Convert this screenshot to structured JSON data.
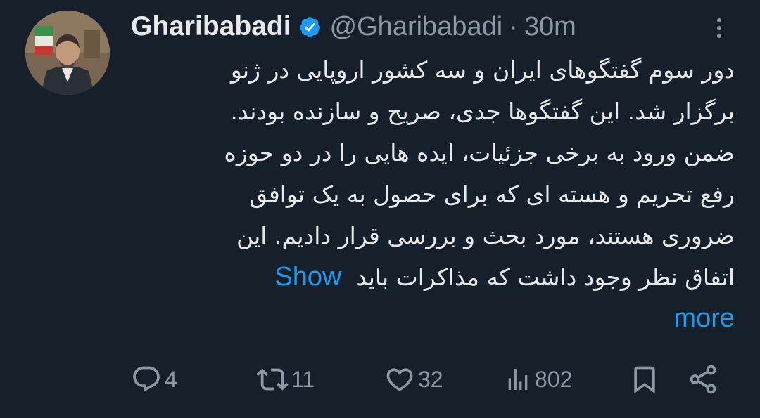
{
  "tweet": {
    "author_name": "Gharibabadi",
    "author_handle": "@Gharibabadi",
    "separator": "·",
    "time": "30m",
    "text_lines": [
      "دور سوم گفتگوهای ایران و سه کشور اروپایی در ژنو",
      "برگزار شد. این گفتگوها جدی، صریح و سازنده بودند.",
      "ضمن ورود به برخی جزئیات، ایده هایی را در دو حوزه",
      "رفع تحریم و هسته ای که برای حصول به یک توافق",
      "ضروری هستند، مورد بحث و بررسی قرار دادیم. این",
      "اتفاق نظر وجود داشت که مذاکرات باید"
    ],
    "show_more_1": "Show",
    "show_more_2": "more"
  },
  "actions": {
    "replies": "4",
    "reposts": "11",
    "likes": "32",
    "views": "802"
  },
  "icons": {
    "verified": "verified-badge-icon",
    "more": "more-options-icon",
    "reply": "reply-icon",
    "repost": "repost-icon",
    "like": "heart-icon",
    "views": "views-chart-icon",
    "bookmark": "bookmark-icon",
    "share": "share-icon"
  },
  "colors": {
    "background": "#15202b",
    "text": "#e7e9ea",
    "secondary": "#8b98a5",
    "accent": "#1d9bf0"
  }
}
